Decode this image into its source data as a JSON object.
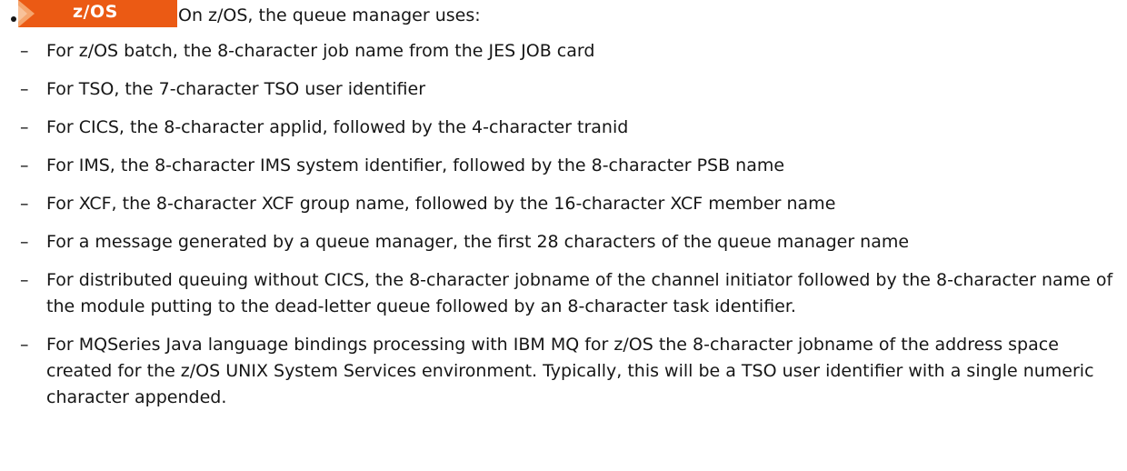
{
  "badge": {
    "label": "z/OS"
  },
  "intro": "On z/OS, the queue manager uses:",
  "dash": "–",
  "items": [
    "For z/OS batch, the 8-character job name from the JES JOB card",
    "For TSO, the 7-character TSO user identifier",
    "For CICS, the 8-character applid, followed by the 4-character tranid",
    "For IMS, the 8-character IMS system identifier, followed by the 8-character PSB name",
    "For XCF, the 8-character XCF group name, followed by the 16-character XCF member name",
    "For a message generated by a queue manager, the first 28 characters of the queue manager name",
    "For distributed queuing without CICS, the 8-character jobname of the channel initiator followed by the 8-character name of the module putting to the dead-letter queue followed by an 8-character task identifier.",
    "For MQSeries Java language bindings processing with IBM MQ for z/OS the 8-character jobname of the address space created for the z/OS UNIX System Services environment. Typically, this will be a TSO user identifier with a single numeric character appended."
  ]
}
